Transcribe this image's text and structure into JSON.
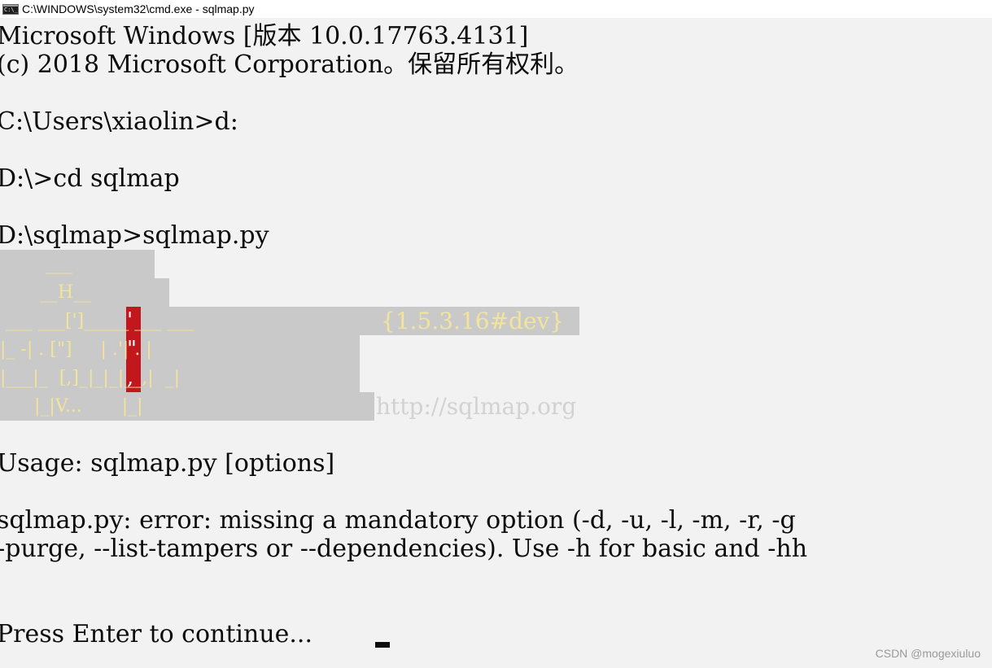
{
  "window": {
    "title": "C:\\WINDOWS\\system32\\cmd.exe - sqlmap.py",
    "icon": "cmd-icon"
  },
  "console": {
    "header_lines": [
      "Microsoft Windows [版本 10.0.17763.4131]",
      "(c) 2018 Microsoft Corporation。保留所有权利。"
    ],
    "commands": [
      "C:\\Users\\xiaolin>d:",
      "D:\\>cd sqlmap",
      "D:\\sqlmap>sqlmap.py"
    ],
    "banner": {
      "row1": "        ___",
      "row2": "       __H__",
      "row3": " ___ ___[']_____ ___ ___",
      "row4": "|_ -| . [\"]     | .'| . |",
      "row5": "|___|_  [,]_|_|_|__,|  _|",
      "row6": "      |_|V...       |_|",
      "quote_top": "'",
      "quote_mid": "\"",
      "quote_bot": ",",
      "version": "{1.5.3.16#dev}",
      "url": "http://sqlmap.org"
    },
    "usage": "Usage: sqlmap.py [options]",
    "error_line1": "sqlmap.py: error: missing a mandatory option (-d, -u, -l, -m, -r, -g",
    "error_line2": "--purge, --list-tampers or --dependencies). Use -h for basic and -hh",
    "prompt": "Press Enter to continue..."
  },
  "watermark": "CSDN @mogexiuluo",
  "colors": {
    "console_bg": "#f2f2f2",
    "text": "#0c0c0c",
    "banner_highlight": "#c9c9c9",
    "banner_text": "#f3e49b",
    "red_bar": "#c2171c"
  }
}
